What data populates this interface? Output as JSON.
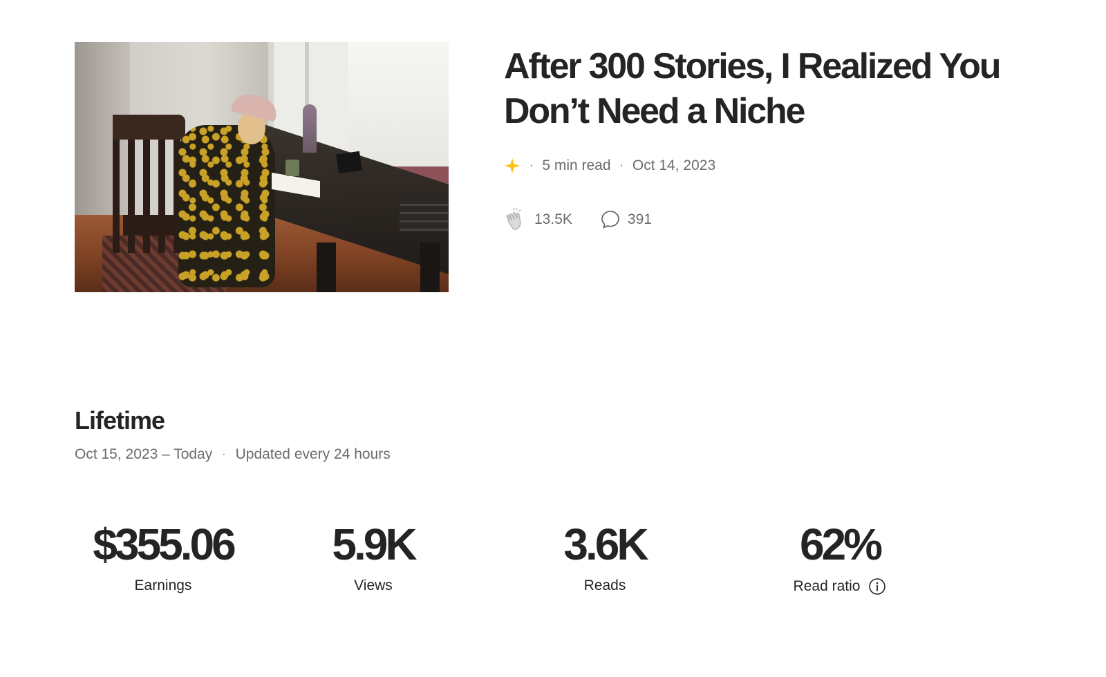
{
  "story": {
    "title": "After 300 Stories, I Realized You Don’t Need a Niche",
    "read_time": "5 min read",
    "published_date": "Oct 14, 2023",
    "member_only_icon": "star-icon",
    "claps": "13.5K",
    "responses": "391",
    "hero_image_icon": "woman-writing-at-desk-photo"
  },
  "lifetime": {
    "title": "Lifetime",
    "date_range": "Oct 15, 2023 – Today",
    "update_note": "Updated every 24 hours"
  },
  "stats": [
    {
      "value": "$355.06",
      "label": "Earnings"
    },
    {
      "value": "5.9K",
      "label": "Views"
    },
    {
      "value": "3.6K",
      "label": "Reads"
    },
    {
      "value": "62%",
      "label": "Read ratio"
    }
  ],
  "colors": {
    "text_primary": "#242424",
    "text_secondary": "#6b6b6b",
    "star_accent": "#FFC017",
    "background": "#ffffff"
  }
}
